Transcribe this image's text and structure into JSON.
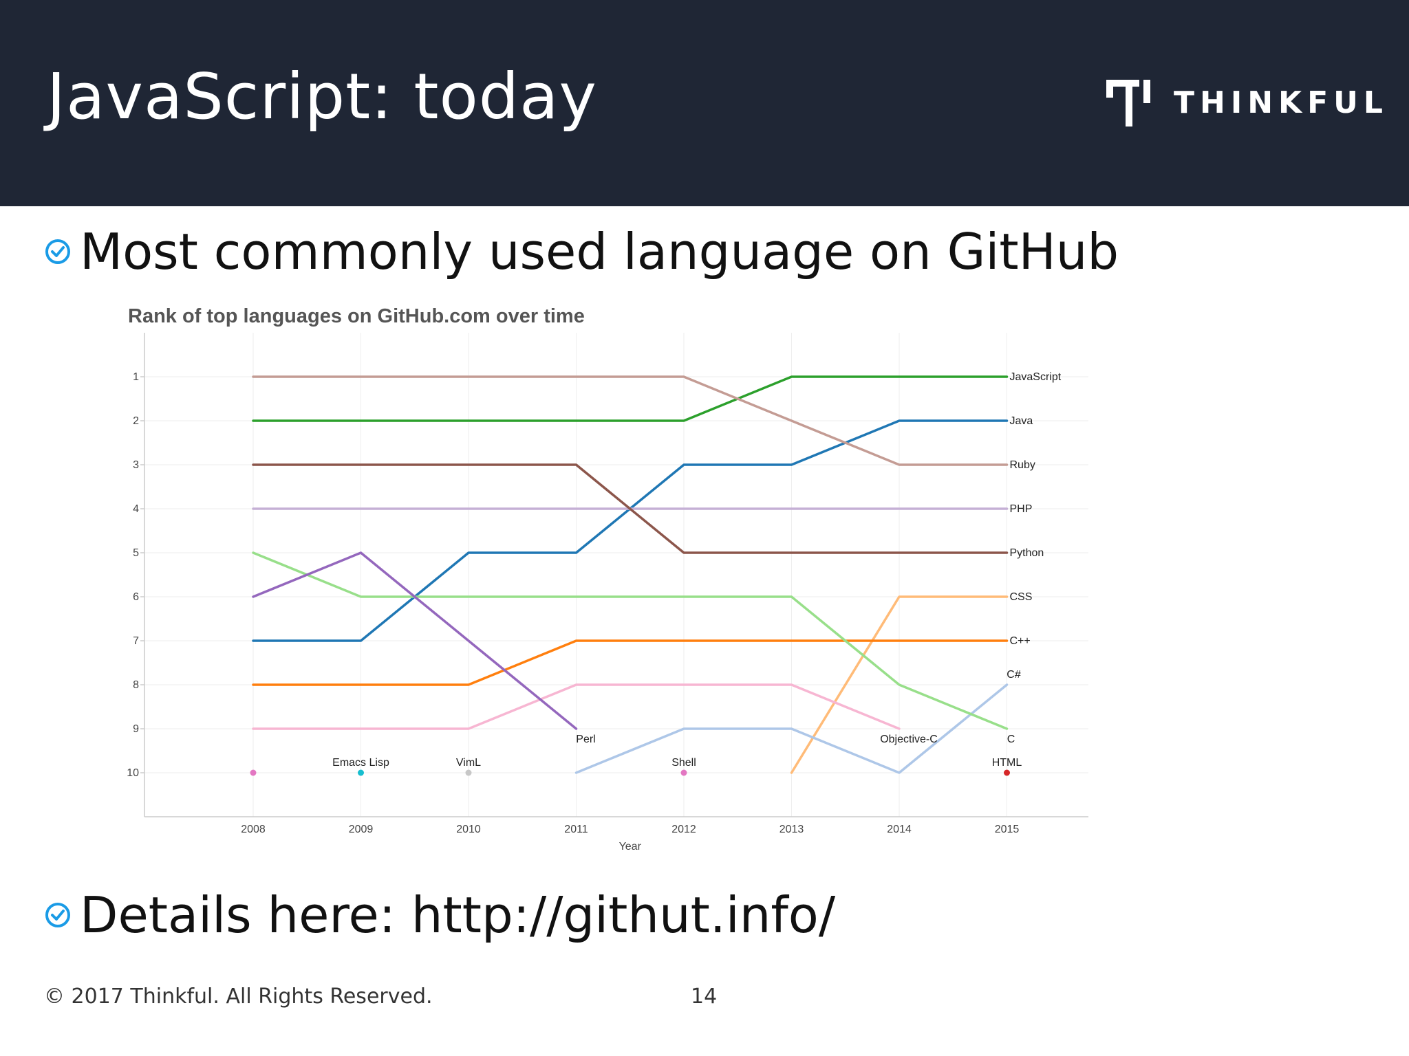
{
  "slide": {
    "title": "JavaScript: today",
    "logo_text": "THINKFUL",
    "bullets": [
      "Most commonly used language on GitHub",
      "Details here: http://githut.info/"
    ],
    "footer": {
      "copyright": "© 2017 Thinkful. All Rights Reserved.",
      "page_number": "14"
    },
    "colors": {
      "header_bg": "#1f2635",
      "bullet_icon": "#1a9be6"
    }
  },
  "chart_data": {
    "type": "line",
    "title": "Rank of top languages on GitHub.com over time",
    "xlabel": "Year",
    "ylabel": "",
    "x": [
      2008,
      2009,
      2010,
      2011,
      2012,
      2013,
      2014,
      2015
    ],
    "x_tick_labels": [
      "2008",
      "2009",
      "2010",
      "2011",
      "2012",
      "2013",
      "2014",
      "2015"
    ],
    "y_ticks": [
      1,
      2,
      3,
      4,
      5,
      6,
      7,
      8,
      9,
      10
    ],
    "y_tick_labels": [
      "1",
      "2",
      "3",
      "4",
      "5",
      "6",
      "7",
      "8",
      "9",
      "10"
    ],
    "y_inverted": true,
    "ylim": [
      10,
      1
    ],
    "xlim": [
      2008,
      2015
    ],
    "grid": true,
    "series": [
      {
        "name": "JavaScript",
        "color": "#2ca02c",
        "x": [
          2008,
          2009,
          2010,
          2011,
          2012,
          2013,
          2014,
          2015
        ],
        "y": [
          2,
          2,
          2,
          2,
          2,
          1,
          1,
          1
        ],
        "label": "JavaScript",
        "label_pos": "right"
      },
      {
        "name": "Java",
        "color": "#1f77b4",
        "x": [
          2008,
          2009,
          2010,
          2011,
          2012,
          2013,
          2014,
          2015
        ],
        "y": [
          7,
          7,
          5,
          5,
          3,
          3,
          2,
          2
        ],
        "label": "Java",
        "label_pos": "right"
      },
      {
        "name": "Ruby",
        "color": "#c49c94",
        "x": [
          2008,
          2009,
          2010,
          2011,
          2012,
          2013,
          2014,
          2015
        ],
        "y": [
          1,
          1,
          1,
          1,
          1,
          2,
          3,
          3
        ],
        "label": "Ruby",
        "label_pos": "right"
      },
      {
        "name": "PHP",
        "color": "#c5b0d5",
        "x": [
          2008,
          2009,
          2010,
          2011,
          2012,
          2013,
          2014,
          2015
        ],
        "y": [
          4,
          4,
          4,
          4,
          4,
          4,
          4,
          4
        ],
        "label": "PHP",
        "label_pos": "right"
      },
      {
        "name": "Python",
        "color": "#8c564b",
        "x": [
          2008,
          2009,
          2010,
          2011,
          2012,
          2013,
          2014,
          2015
        ],
        "y": [
          3,
          3,
          3,
          3,
          5,
          5,
          5,
          5
        ],
        "label": "Python",
        "label_pos": "right"
      },
      {
        "name": "CSS",
        "color": "#ffbb78",
        "x": [
          2013,
          2014,
          2015
        ],
        "y": [
          10,
          6,
          6
        ],
        "label": "CSS",
        "label_pos": "right"
      },
      {
        "name": "C++",
        "color": "#ff7f0e",
        "x": [
          2008,
          2009,
          2010,
          2011,
          2012,
          2013,
          2014,
          2015
        ],
        "y": [
          8,
          8,
          8,
          7,
          7,
          7,
          7,
          7
        ],
        "label": "C++",
        "label_pos": "right"
      },
      {
        "name": "C#",
        "color": "#aec7e8",
        "x": [
          2011,
          2012,
          2013,
          2014,
          2015
        ],
        "y": [
          10,
          9,
          9,
          10,
          8
        ],
        "label": "C#",
        "label_pos": "above"
      },
      {
        "name": "C",
        "color": "#98df8a",
        "x": [
          2008,
          2009,
          2010,
          2011,
          2012,
          2013,
          2014,
          2015
        ],
        "y": [
          5,
          6,
          6,
          6,
          6,
          6,
          8,
          9
        ],
        "label": "C",
        "label_pos": "below"
      },
      {
        "name": "Objective-C",
        "color": "#f7b6d2",
        "x": [
          2008,
          2009,
          2010,
          2011,
          2012,
          2013,
          2014
        ],
        "y": [
          9,
          9,
          9,
          8,
          8,
          8,
          9
        ],
        "label": "Objective-C",
        "label_pos": "below"
      },
      {
        "name": "Perl",
        "color": "#9467bd",
        "x": [
          2008,
          2009,
          2010,
          2011
        ],
        "y": [
          6,
          5,
          7,
          9
        ],
        "label": "Perl",
        "label_pos": "below"
      },
      {
        "name": "Shell",
        "color": "#e377c2",
        "x": [
          2008
        ],
        "y": [
          10
        ],
        "label": "",
        "label_pos": "none"
      },
      {
        "name": "Emacs Lisp",
        "color": "#17becf",
        "x": [
          2009
        ],
        "y": [
          10
        ],
        "label": "Emacs Lisp",
        "label_pos": "above"
      },
      {
        "name": "VimL",
        "color": "#c7c7c7",
        "x": [
          2010
        ],
        "y": [
          10
        ],
        "label": "VimL",
        "label_pos": "above"
      },
      {
        "name": "Shell",
        "color": "#e377c2",
        "x": [
          2012
        ],
        "y": [
          10
        ],
        "label": "Shell",
        "label_pos": "above"
      },
      {
        "name": "HTML",
        "color": "#d62728",
        "x": [
          2015
        ],
        "y": [
          10
        ],
        "label": "HTML",
        "label_pos": "above"
      }
    ]
  }
}
